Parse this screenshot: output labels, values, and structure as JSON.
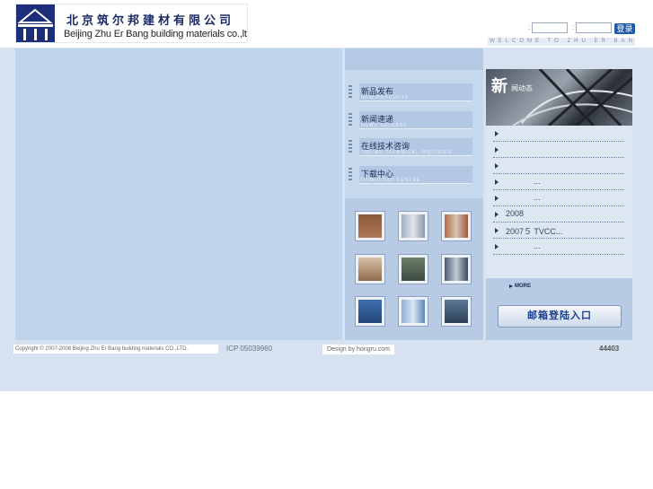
{
  "header": {
    "logo_cn": "北京筑尔邦建材有限公司",
    "logo_en": "Beijing Zhu Er Bang building materials co.,ltd",
    "login_label_1": ":",
    "login_label_2": ":",
    "login_button": "登录",
    "welcome": "WELCOME TO ZHU ER BANG"
  },
  "menu": [
    {
      "cn": "新品发布",
      "en": "NEW PRODUCTS"
    },
    {
      "cn": "新闻速递",
      "en": "NEWS RELEASE"
    },
    {
      "cn": "在线技术咨询",
      "en": "ONLINE TECHNICAL INQUIRIES"
    },
    {
      "cn": "下载中心",
      "en": "DOWNLOAD CENTRE"
    }
  ],
  "news": {
    "title": "新",
    "subtitle": "闻动态",
    "items": [
      "",
      "",
      "",
      "...",
      "...",
      "2008",
      "2007５ TVCC...",
      "..."
    ],
    "more": "MORE",
    "mail_button": "邮箱登陆入口"
  },
  "footer": {
    "copyright": "Copyright © 2007-2008 Beijing Zhu Er Bang building materials CO.,LTD.",
    "icp": "ICP 05039960",
    "design": "Design by hongru.com",
    "count": "44403"
  },
  "colors": {
    "brand_blue": "#1d2e7a",
    "background_band": "#d6e2ef",
    "accent_button": "#1f5aa8"
  }
}
